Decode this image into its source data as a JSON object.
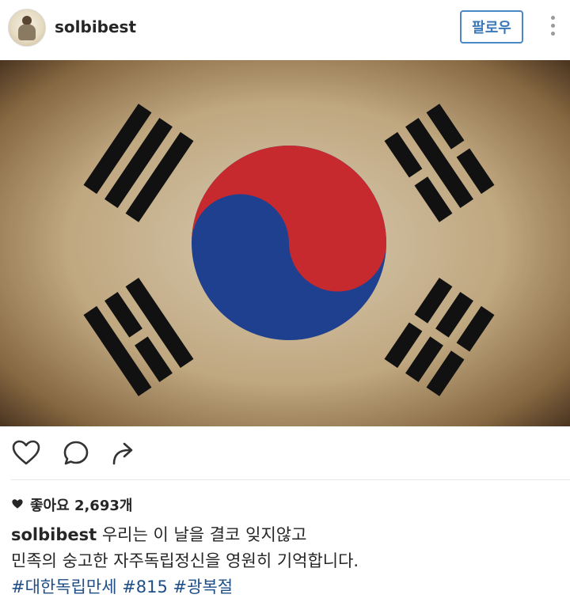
{
  "header": {
    "username": "solbibest",
    "follow_label": "팔로우"
  },
  "icons": {
    "like": "heart-outline-icon",
    "comment": "comment-bubble-icon",
    "share": "share-arrow-icon",
    "more": "more-vertical-icon"
  },
  "post": {
    "likes": "좋아요 2,693개",
    "caption_user": "solbibest",
    "caption_line1": "우리는 이 날을 결코 잊지않고",
    "caption_line2": "민족의 숭고한 자주독립정신을 영원히 기억합니다.",
    "hashtags": "#대한독립만세 #815 #광복절"
  },
  "colors": {
    "follow_blue": "#3b79b8",
    "hashtag_blue": "#1f4f87",
    "flag_red": "#c62a2f",
    "flag_blue": "#1f3f8f"
  }
}
